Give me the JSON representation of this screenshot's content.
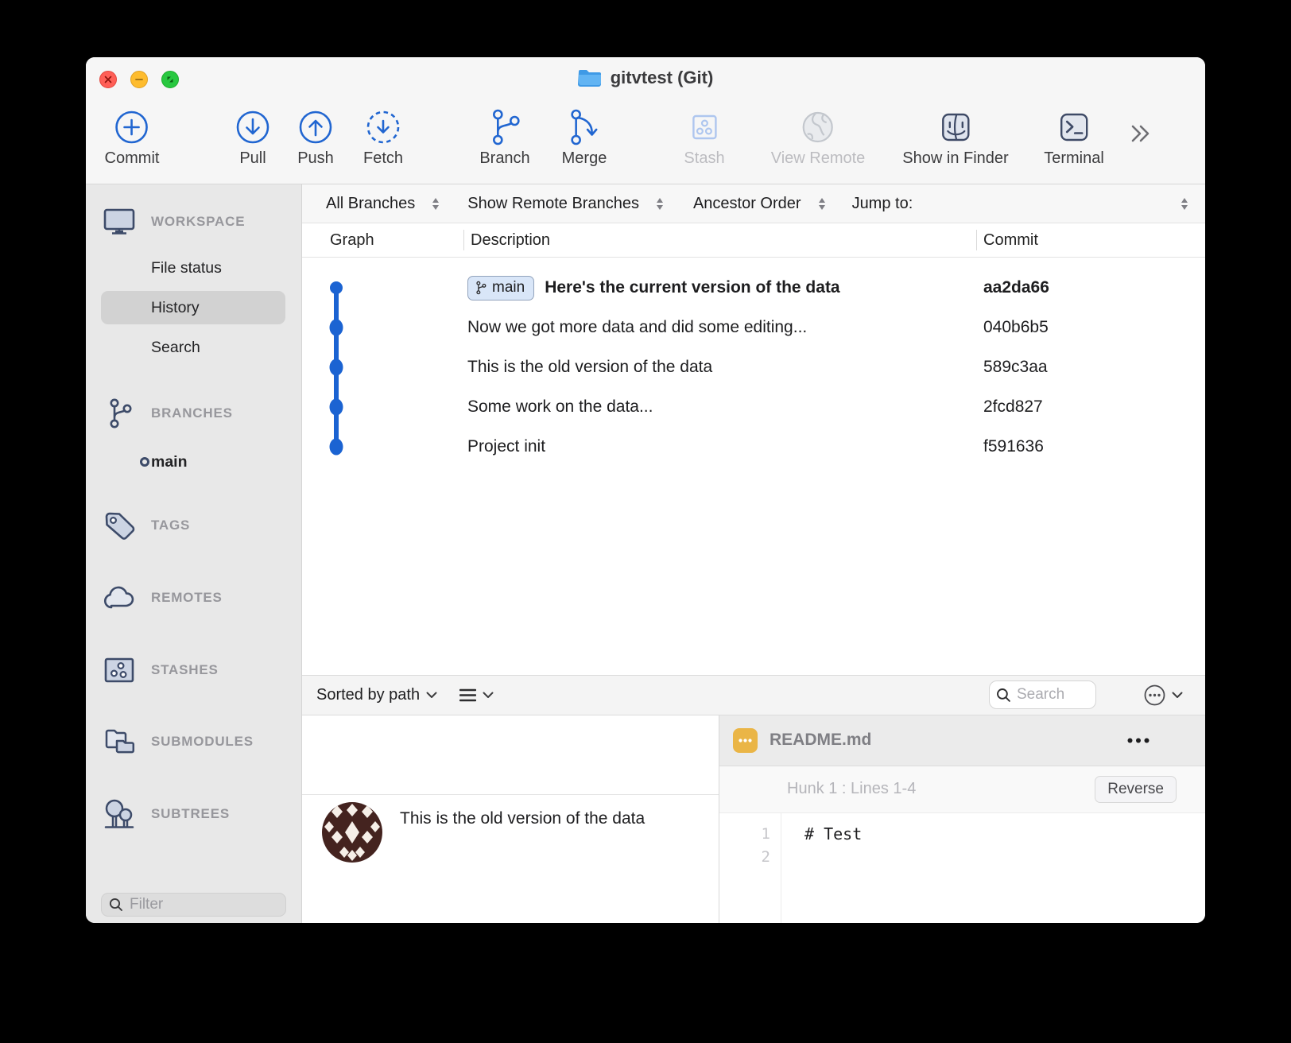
{
  "window_title": "gitvtest (Git)",
  "toolbar": {
    "commit": "Commit",
    "pull": "Pull",
    "push": "Push",
    "fetch": "Fetch",
    "branch": "Branch",
    "merge": "Merge",
    "stash": "Stash",
    "view_remote": "View Remote",
    "show_in_finder": "Show in Finder",
    "terminal": "Terminal"
  },
  "sidebar": {
    "workspace": {
      "label": "WORKSPACE",
      "items": [
        "File status",
        "History",
        "Search"
      ],
      "selected": "History"
    },
    "branches": {
      "label": "BRANCHES",
      "items": [
        "main"
      ]
    },
    "tags": "TAGS",
    "remotes": "REMOTES",
    "stashes": "STASHES",
    "submodules": "SUBMODULES",
    "subtrees": "SUBTREES",
    "filter_placeholder": "Filter"
  },
  "history_controls": {
    "branch_filter": "All Branches",
    "remote_filter": "Show Remote Branches",
    "order": "Ancestor Order",
    "jump_to": "Jump to:"
  },
  "history_table": {
    "columns": [
      "Graph",
      "Description",
      "Commit"
    ],
    "commits": [
      {
        "badge": "main",
        "message": "Here's the current version of the data",
        "hash": "aa2da66"
      },
      {
        "message": "Now we got more data and did some editing...",
        "hash": "040b6b5"
      },
      {
        "message": "This is the old version of the data",
        "hash": "589c3aa"
      },
      {
        "message": "Some work on the data...",
        "hash": "2fcd827"
      },
      {
        "message": "Project init",
        "hash": "f591636"
      }
    ]
  },
  "file_panel": {
    "sort_label": "Sorted by path",
    "search_placeholder": "Search"
  },
  "commit_detail": {
    "message": "This is the old version of the data"
  },
  "diff_panel": {
    "filename": "README.md",
    "hunk_header": "Hunk 1 : Lines 1-4",
    "reverse_button": "Reverse",
    "lines": [
      {
        "number": "1",
        "code": "# Test"
      },
      {
        "number": "2",
        "code": ""
      }
    ]
  },
  "colors": {
    "accent_blue": "#1b63d2",
    "badge_bg": "#d9e6f8",
    "file_icon_orange": "#eab546",
    "graph_blue": "#1b63d2"
  }
}
